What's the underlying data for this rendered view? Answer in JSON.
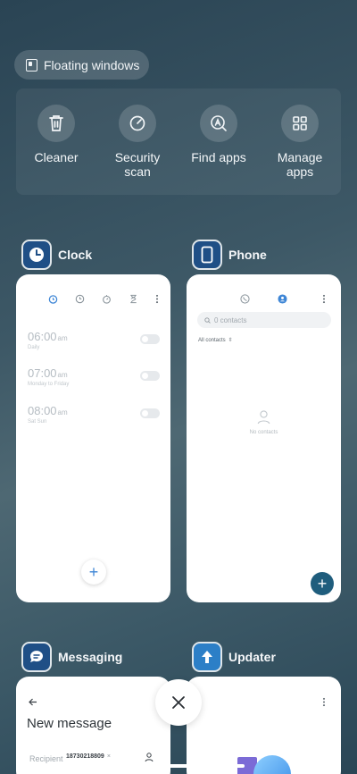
{
  "floating_windows": {
    "label": "Floating windows"
  },
  "tools": [
    {
      "label": "Cleaner",
      "icon": "trash-icon"
    },
    {
      "label": "Security\nscan",
      "icon": "security-icon"
    },
    {
      "label": "Find apps",
      "icon": "find-apps-icon"
    },
    {
      "label": "Manage\napps",
      "icon": "grid-icon"
    }
  ],
  "apps": {
    "clock": {
      "name": "Clock",
      "alarms": [
        {
          "time": "06:00",
          "ampm": "am",
          "sub": "Daily"
        },
        {
          "time": "07:00",
          "ampm": "am",
          "sub": "Monday to Friday"
        },
        {
          "time": "08:00",
          "ampm": "am",
          "sub": "Sat Sun"
        }
      ]
    },
    "phone": {
      "name": "Phone",
      "search_placeholder": "0 contacts",
      "filter": "All contacts",
      "empty_text": "No contacts"
    },
    "messaging": {
      "name": "Messaging",
      "title": "New message",
      "recipient_label": "Recipient",
      "recipient_chip": "18730218809"
    },
    "updater": {
      "name": "Updater"
    }
  },
  "colors": {
    "accent_blue": "#3e86d6",
    "teal_fab": "#1f5d7d",
    "app_icon_bg": "#1f4f86"
  }
}
